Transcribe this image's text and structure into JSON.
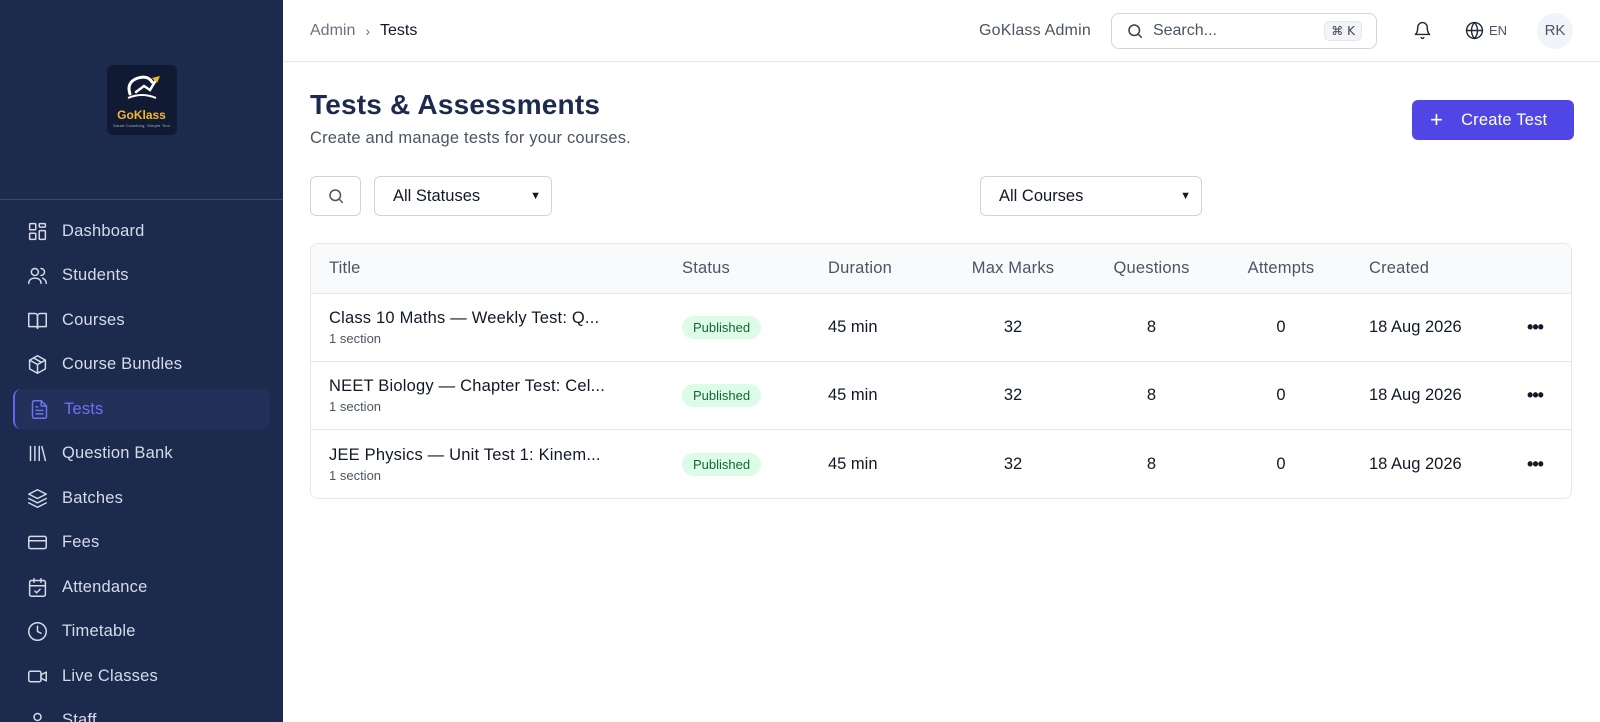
{
  "brand": {
    "name": "GoKlass",
    "tagline": "Smart Coaching, Simple Tool"
  },
  "sidebar": {
    "items": [
      {
        "label": "Dashboard",
        "icon": "grid-icon",
        "active": false
      },
      {
        "label": "Students",
        "icon": "users-icon",
        "active": false
      },
      {
        "label": "Courses",
        "icon": "book-open-icon",
        "active": false
      },
      {
        "label": "Course Bundles",
        "icon": "package-icon",
        "active": false
      },
      {
        "label": "Tests",
        "icon": "file-text-icon",
        "active": true
      },
      {
        "label": "Question Bank",
        "icon": "library-icon",
        "active": false
      },
      {
        "label": "Batches",
        "icon": "layers-icon",
        "active": false
      },
      {
        "label": "Fees",
        "icon": "credit-card-icon",
        "active": false
      },
      {
        "label": "Attendance",
        "icon": "calendar-check-icon",
        "active": false
      },
      {
        "label": "Timetable",
        "icon": "clock-icon",
        "active": false
      },
      {
        "label": "Live Classes",
        "icon": "video-icon",
        "active": false
      },
      {
        "label": "Staff",
        "icon": "user-icon",
        "active": false
      }
    ]
  },
  "topbar": {
    "breadcrumb": {
      "root": "Admin",
      "separator": "›",
      "current": "Tests"
    },
    "admin_name": "GoKlass Admin",
    "search_placeholder": "Search...",
    "shortcut": "⌘ K",
    "language": "EN",
    "avatar_initials": "RK"
  },
  "page": {
    "title": "Tests & Assessments",
    "subtitle": "Create and manage tests for your courses.",
    "create_button": "Create Test"
  },
  "filters": {
    "status_selected": "All Statuses",
    "course_selected": "All Courses"
  },
  "table": {
    "columns": {
      "title": "Title",
      "status": "Status",
      "duration": "Duration",
      "max_marks": "Max Marks",
      "questions": "Questions",
      "attempts": "Attempts",
      "created": "Created"
    },
    "rows": [
      {
        "title": "Class 10 Maths — Weekly Test: Q...",
        "sections": "1 section",
        "status": "Published",
        "duration": "45 min",
        "max_marks": "32",
        "questions": "8",
        "attempts": "0",
        "created": "18 Aug 2026"
      },
      {
        "title": "NEET Biology — Chapter Test: Cel...",
        "sections": "1 section",
        "status": "Published",
        "duration": "45 min",
        "max_marks": "32",
        "questions": "8",
        "attempts": "0",
        "created": "18 Aug 2026"
      },
      {
        "title": "JEE Physics — Unit Test 1: Kinem...",
        "sections": "1 section",
        "status": "Published",
        "duration": "45 min",
        "max_marks": "32",
        "questions": "8",
        "attempts": "0",
        "created": "18 Aug 2026"
      }
    ]
  },
  "colors": {
    "sidebar_bg": "#1c2a4d",
    "accent": "#5046e5",
    "badge_bg": "#dcfce7",
    "badge_text": "#166534"
  }
}
